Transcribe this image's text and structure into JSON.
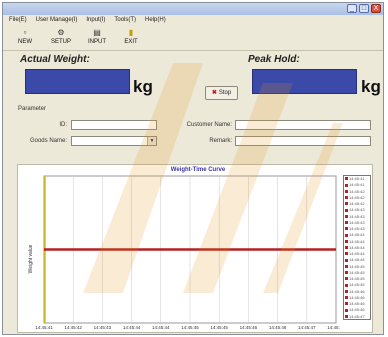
{
  "window": {
    "controls": [
      "_",
      "□",
      "X"
    ]
  },
  "menu": [
    {
      "label": "File(E)"
    },
    {
      "label": "User Manage(I)"
    },
    {
      "label": "Input(I)"
    },
    {
      "label": "Tools(T)"
    },
    {
      "label": "Help(H)"
    }
  ],
  "toolbar": [
    {
      "label": "NEW",
      "icon": "new-file-icon",
      "glyph": "▫"
    },
    {
      "label": "SETUP",
      "icon": "setup-icon",
      "glyph": "⚙"
    },
    {
      "label": "INPUT",
      "icon": "input-icon",
      "glyph": "▤"
    },
    {
      "label": "EXIT",
      "icon": "exit-icon",
      "glyph": "▮"
    }
  ],
  "actual": {
    "label": "Actual Weight:",
    "value": "",
    "unit": "kg"
  },
  "peak": {
    "label": "Peak Hold:",
    "value": "",
    "unit": "kg"
  },
  "stop_button": {
    "label": "Stop"
  },
  "parameter": {
    "title": "Parameter",
    "id_label": "ID:",
    "id_value": "",
    "goods_label": "Goods Name:",
    "goods_value": "",
    "customer_label": "Customer Name:",
    "customer_value": "",
    "remark_label": "Remark:",
    "remark_value": ""
  },
  "chart_data": {
    "type": "line",
    "title": "Weight-Time Curve",
    "ylabel": "Weight value",
    "xlabel": "",
    "x": [
      "14:45:41",
      "14:45:42",
      "14:45:43",
      "14:45:44",
      "14:45:44",
      "14:45:45",
      "14:45:45",
      "14:45:46",
      "14:45:46",
      "14:45:47",
      "14:45:48"
    ],
    "series": [
      {
        "values": [
          0,
          0,
          0,
          0,
          0,
          0,
          0,
          0,
          0,
          0,
          0
        ]
      }
    ],
    "legend": [
      "14:45:41",
      "14:45:41",
      "14:45:42",
      "14:45:42",
      "14:45:42",
      "14:45:43",
      "14:45:43",
      "14:45:43",
      "14:45:43",
      "14:45:44",
      "14:45:44",
      "14:45:44",
      "14:45:44",
      "14:45:44",
      "14:45:45",
      "14:45:45",
      "14:45:45",
      "14:45:45",
      "14:45:46",
      "14:45:46",
      "14:45:46",
      "14:45:46",
      "14:45:47",
      "14:45:47"
    ],
    "grid": true,
    "colors": {
      "line": "#b52020",
      "axis": "#d9c300"
    }
  },
  "colors": {
    "display": "#3b49a8",
    "window": "#ece9d8",
    "chart_title": "#3a34a6"
  }
}
